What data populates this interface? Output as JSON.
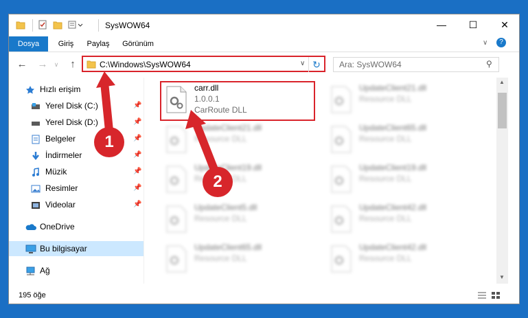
{
  "window": {
    "title": "SysWOW64"
  },
  "ribbon": {
    "tabs": [
      "Dosya",
      "Giriş",
      "Paylaş",
      "Görünüm"
    ]
  },
  "address": {
    "path": "C:\\Windows\\SysWOW64",
    "search_placeholder": "Ara: SysWOW64"
  },
  "sidebar": {
    "items": [
      {
        "label": "Hızlı erişim"
      },
      {
        "label": "Yerel Disk (C:)"
      },
      {
        "label": "Yerel Disk (D:)"
      },
      {
        "label": "Belgeler"
      },
      {
        "label": "İndirmeler"
      },
      {
        "label": "Müzik"
      },
      {
        "label": "Resimler"
      },
      {
        "label": "Videolar"
      },
      {
        "label": "OneDrive"
      },
      {
        "label": "Bu bilgisayar"
      },
      {
        "label": "Ağ"
      }
    ]
  },
  "files": {
    "highlight": {
      "name": "carr.dll",
      "version": "1.0.0.1",
      "desc": "CarRoute DLL"
    },
    "blurred": [
      {
        "name": "UpdateClient21.dll",
        "desc": "Resource DLL"
      },
      {
        "name": "UpdateClient21.dll",
        "desc": "Resource DLL"
      },
      {
        "name": "UpdateClient65.dll",
        "desc": "Resource DLL"
      },
      {
        "name": "UpdateClient19.dll",
        "desc": "Resource DLL"
      },
      {
        "name": "UpdateClient19.dll",
        "desc": "Resource DLL"
      },
      {
        "name": "UpdateClient5.dll",
        "desc": "Resource DLL"
      },
      {
        "name": "UpdateClient42.dll",
        "desc": "Resource DLL"
      },
      {
        "name": "UpdateClient65.dll",
        "desc": "Resource DLL"
      },
      {
        "name": "UpdateClient42.dll",
        "desc": "Resource DLL"
      }
    ]
  },
  "status": {
    "count": "195 öğe"
  },
  "badges": {
    "one": "1",
    "two": "2"
  },
  "colors": {
    "accent": "#1979ca",
    "highlight": "#d9232a"
  }
}
